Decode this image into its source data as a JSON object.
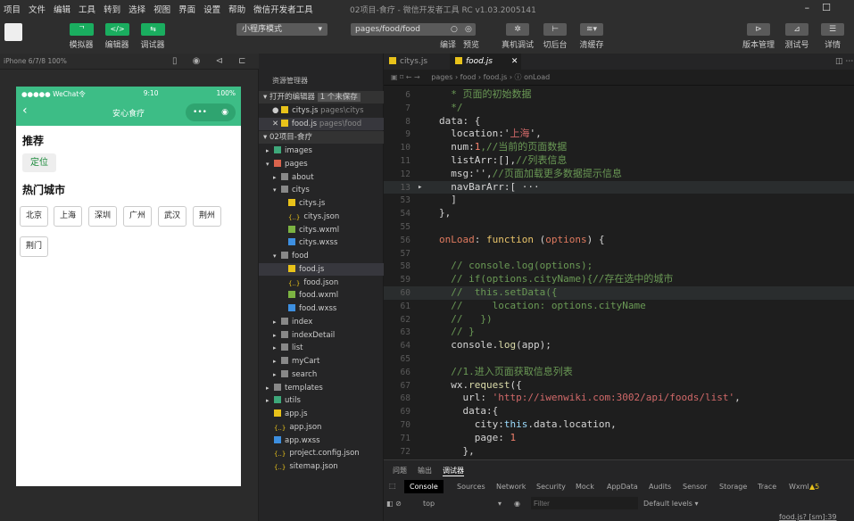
{
  "menu": [
    "项目",
    "文件",
    "编辑",
    "工具",
    "转到",
    "选择",
    "视图",
    "界面",
    "设置",
    "帮助",
    "微信开发者工具"
  ],
  "window_title": "02项目-食疗 - 微信开发者工具 RC v1.03.2005141",
  "toolbar": {
    "simulator": "模拟器",
    "editor": "编辑器",
    "debugger": "调试器",
    "mode": "小程序模式",
    "page_path": "pages/food/food",
    "compile": "编译",
    "preview": "预览",
    "remote_debug": "真机调试",
    "background": "切后台",
    "clear_cache": "清缓存",
    "version": "版本管理",
    "test": "测试号",
    "details": "详情"
  },
  "sim": {
    "device": "iPhone 6/7/8 100%",
    "carrier": "●●●●● WeChat令",
    "time": "9:10",
    "battery": "100%",
    "nav_title": "安心食疗",
    "recommend": "推荐",
    "locate": "定位",
    "hot": "热门城市",
    "cities": [
      "北京",
      "上海",
      "深圳",
      "广州",
      "武汉",
      "荆州",
      "荆门"
    ]
  },
  "tree": {
    "title": "资源管理器",
    "open_editors": "打开的编辑器",
    "unsaved": "1 个未保存",
    "open": [
      {
        "name": "citys.js",
        "path": "pages\\citys"
      },
      {
        "name": "food.js",
        "path": "pages\\food"
      }
    ],
    "project": "02项目-食疗",
    "items": [
      {
        "n": "images",
        "d": 1,
        "t": "folder-g"
      },
      {
        "n": "pages",
        "d": 1,
        "t": "folder-r"
      },
      {
        "n": "about",
        "d": 2,
        "t": "folder"
      },
      {
        "n": "citys",
        "d": 2,
        "t": "folder-open"
      },
      {
        "n": "citys.js",
        "d": 3,
        "t": "js"
      },
      {
        "n": "citys.json",
        "d": 3,
        "t": "json"
      },
      {
        "n": "citys.wxml",
        "d": 3,
        "t": "wxml"
      },
      {
        "n": "citys.wxss",
        "d": 3,
        "t": "wxss"
      },
      {
        "n": "food",
        "d": 2,
        "t": "folder-open"
      },
      {
        "n": "food.js",
        "d": 3,
        "t": "js"
      },
      {
        "n": "food.json",
        "d": 3,
        "t": "json"
      },
      {
        "n": "food.wxml",
        "d": 3,
        "t": "wxml"
      },
      {
        "n": "food.wxss",
        "d": 3,
        "t": "wxss"
      },
      {
        "n": "index",
        "d": 2,
        "t": "folder"
      },
      {
        "n": "indexDetail",
        "d": 2,
        "t": "folder"
      },
      {
        "n": "list",
        "d": 2,
        "t": "folder"
      },
      {
        "n": "myCart",
        "d": 2,
        "t": "folder"
      },
      {
        "n": "search",
        "d": 2,
        "t": "folder"
      },
      {
        "n": "templates",
        "d": 1,
        "t": "folder"
      },
      {
        "n": "utils",
        "d": 1,
        "t": "folder-g"
      },
      {
        "n": "app.js",
        "d": 1,
        "t": "js"
      },
      {
        "n": "app.json",
        "d": 1,
        "t": "json"
      },
      {
        "n": "app.wxss",
        "d": 1,
        "t": "wxss"
      },
      {
        "n": "project.config.json",
        "d": 1,
        "t": "json"
      },
      {
        "n": "sitemap.json",
        "d": 1,
        "t": "json"
      }
    ]
  },
  "tabs": [
    "citys.js",
    "food.js"
  ],
  "breadcrumb": "pages › food › food.js › ⓘ onLoad",
  "code": [
    {
      "n": "6",
      "s": [
        [
          "  * 页面的初始数据",
          "cm"
        ]
      ]
    },
    {
      "n": "7",
      "s": [
        [
          "  */",
          "cm"
        ]
      ]
    },
    {
      "n": "8",
      "s": [
        [
          "data: {",
          "pl"
        ]
      ]
    },
    {
      "n": "9",
      "s": [
        [
          "  location:'",
          "pl"
        ],
        [
          "上海",
          "st"
        ],
        [
          "',",
          "pl"
        ]
      ]
    },
    {
      "n": "10",
      "s": [
        [
          "  num:",
          "pl"
        ],
        [
          "1",
          "nm"
        ],
        [
          ",//当前的页面数据",
          "cm"
        ]
      ]
    },
    {
      "n": "11",
      "s": [
        [
          "  listArr:[],",
          "pl"
        ],
        [
          "//列表信息",
          "cm"
        ]
      ]
    },
    {
      "n": "12",
      "s": [
        [
          "  msg:'',",
          "pl"
        ],
        [
          "//页面加载更多数据提示信息",
          "cm"
        ]
      ]
    },
    {
      "n": "13",
      "s": [
        [
          "  navBarArr:[ ···",
          "pl"
        ]
      ],
      "fold": true,
      "hl": true
    },
    {
      "n": "53",
      "s": [
        [
          "  ]",
          "pl"
        ]
      ]
    },
    {
      "n": "54",
      "s": [
        [
          "},",
          "pl"
        ]
      ]
    },
    {
      "n": "55",
      "s": [
        [
          "",
          ""
        ]
      ]
    },
    {
      "n": "56",
      "s": [
        [
          "onLoad",
          "or"
        ],
        [
          ": ",
          "pl"
        ],
        [
          "function",
          "kw"
        ],
        [
          " (",
          "pl"
        ],
        [
          "options",
          "or"
        ],
        [
          ") {",
          "pl"
        ]
      ]
    },
    {
      "n": "57",
      "s": [
        [
          "",
          ""
        ]
      ]
    },
    {
      "n": "58",
      "s": [
        [
          "  // console.log(options);",
          "cm"
        ]
      ]
    },
    {
      "n": "59",
      "s": [
        [
          "  // if(options.cityName){//存在选中的城市",
          "cm"
        ]
      ]
    },
    {
      "n": "60",
      "s": [
        [
          "  //  this.setData({",
          "cm"
        ]
      ],
      "hl": true
    },
    {
      "n": "61",
      "s": [
        [
          "  //     location: options.cityName",
          "cm"
        ]
      ]
    },
    {
      "n": "62",
      "s": [
        [
          "  //   })",
          "cm"
        ]
      ]
    },
    {
      "n": "63",
      "s": [
        [
          "  // }",
          "cm"
        ]
      ]
    },
    {
      "n": "64",
      "s": [
        [
          "  console.",
          "pl"
        ],
        [
          "log",
          "fn"
        ],
        [
          "(app);",
          "pl"
        ]
      ]
    },
    {
      "n": "65",
      "s": [
        [
          "",
          ""
        ]
      ]
    },
    {
      "n": "66",
      "s": [
        [
          "  //1.进入页面获取信息列表",
          "cm"
        ]
      ]
    },
    {
      "n": "67",
      "s": [
        [
          "  wx.",
          "pl"
        ],
        [
          "request",
          "fn"
        ],
        [
          "({",
          "pl"
        ]
      ]
    },
    {
      "n": "68",
      "s": [
        [
          "    url: ",
          "pl"
        ],
        [
          "'http://iwenwiki.com:3002/api/foods/list'",
          "st"
        ],
        [
          ",",
          "pl"
        ]
      ]
    },
    {
      "n": "69",
      "s": [
        [
          "    data:{",
          "pl"
        ]
      ]
    },
    {
      "n": "70",
      "s": [
        [
          "      city:",
          "pl"
        ],
        [
          "this",
          "vr"
        ],
        [
          ".data.location,",
          "pl"
        ]
      ]
    },
    {
      "n": "71",
      "s": [
        [
          "      page: ",
          "pl"
        ],
        [
          "1",
          "nm"
        ]
      ]
    },
    {
      "n": "72",
      "s": [
        [
          "    },",
          "pl"
        ]
      ]
    }
  ],
  "devtools": {
    "panels": [
      "问题",
      "输出",
      "调试器"
    ],
    "tabs": [
      "Console",
      "Sources",
      "Network",
      "Security",
      "Mock",
      "AppData",
      "Audits",
      "Sensor",
      "Storage",
      "Trace",
      "Wxml"
    ],
    "warnings": "5",
    "context": "top",
    "filter_placeholder": "Filter",
    "levels": "Default levels ▾",
    "source_link": "food.js? [sm]:39"
  }
}
